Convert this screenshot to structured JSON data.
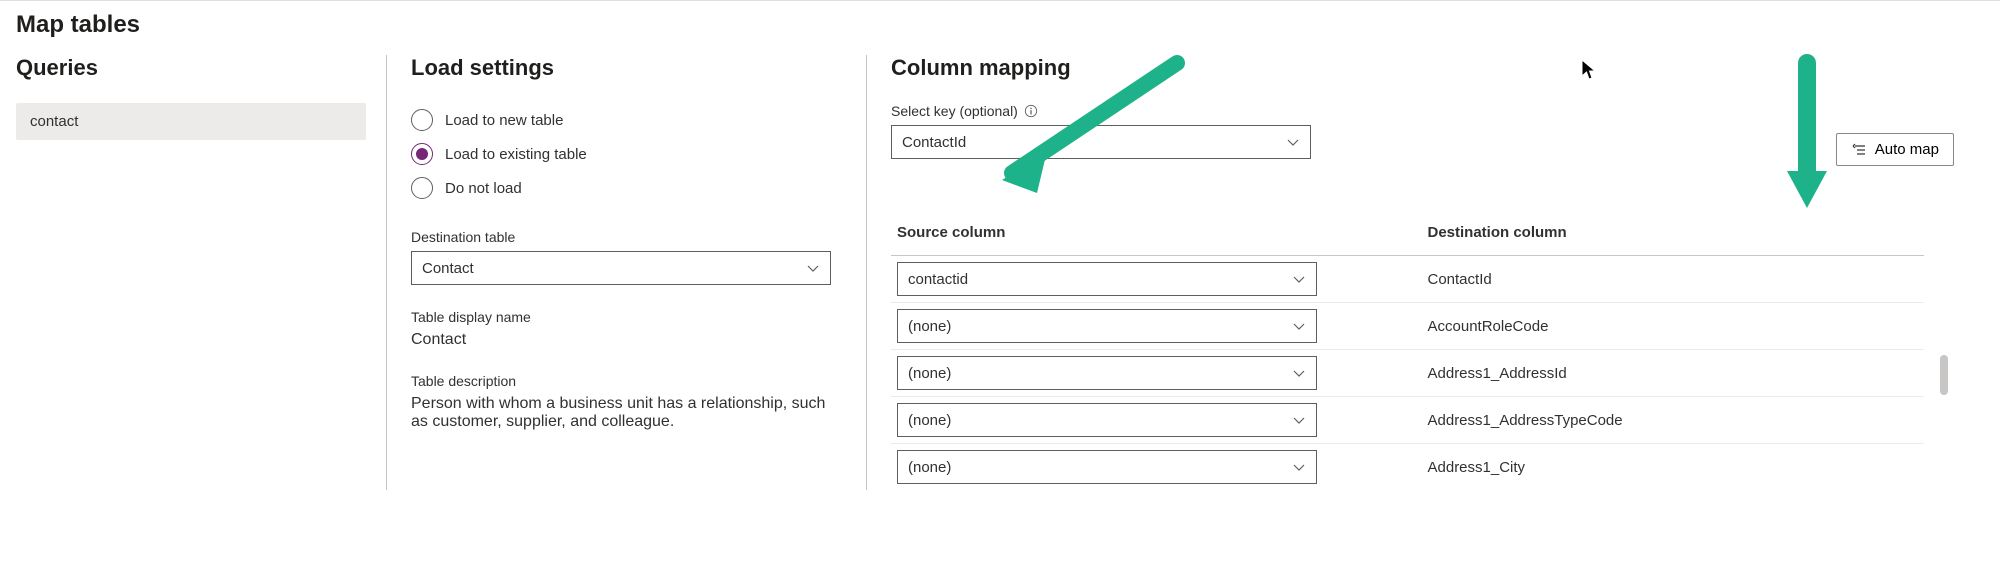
{
  "page_title": "Map tables",
  "queries": {
    "title": "Queries",
    "items": [
      "contact"
    ]
  },
  "load_settings": {
    "title": "Load settings",
    "options": {
      "new": "Load to new table",
      "existing": "Load to existing table",
      "none": "Do not load"
    },
    "selected": "existing",
    "destination_table_label": "Destination table",
    "destination_table_value": "Contact",
    "display_name_label": "Table display name",
    "display_name_value": "Contact",
    "description_label": "Table description",
    "description_value": "Person with whom a business unit has a relationship, such as customer, supplier, and colleague."
  },
  "column_mapping": {
    "title": "Column mapping",
    "select_key_label": "Select key (optional)",
    "select_key_value": "ContactId",
    "automap_label": "Auto map",
    "columns": {
      "source": "Source column",
      "destination": "Destination column"
    },
    "rows": [
      {
        "source": "contactid",
        "destination": "ContactId"
      },
      {
        "source": "(none)",
        "destination": "AccountRoleCode"
      },
      {
        "source": "(none)",
        "destination": "Address1_AddressId"
      },
      {
        "source": "(none)",
        "destination": "Address1_AddressTypeCode"
      },
      {
        "source": "(none)",
        "destination": "Address1_City"
      }
    ]
  }
}
